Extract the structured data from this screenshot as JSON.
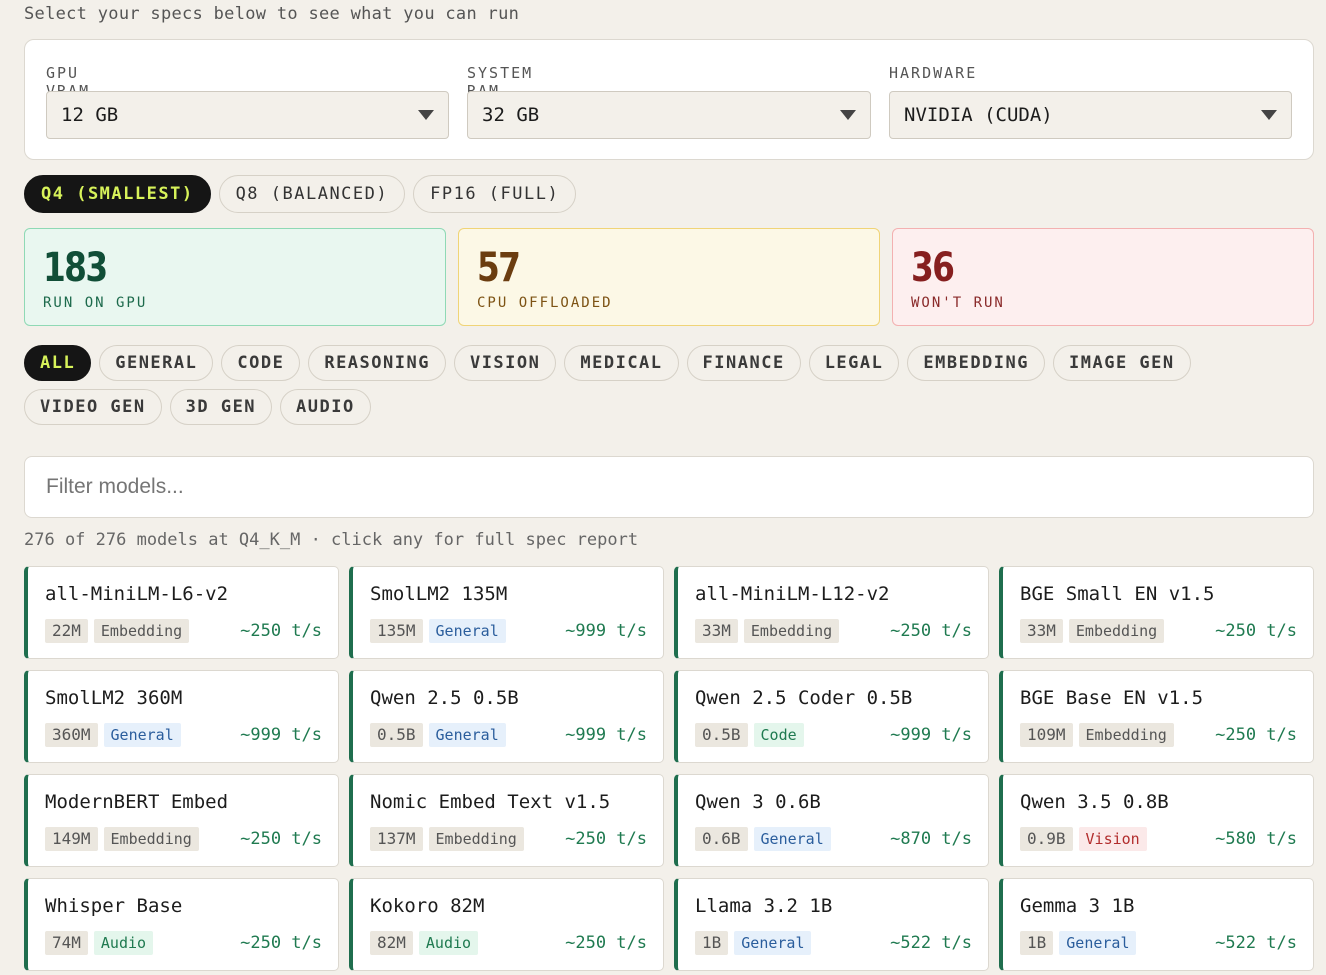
{
  "subtitle": "Select your specs below to see what you can run",
  "specs": [
    {
      "label": "GPU VRAM",
      "value": "12 GB"
    },
    {
      "label": "SYSTEM RAM",
      "value": "32 GB"
    },
    {
      "label": "HARDWARE",
      "value": "NVIDIA (CUDA)"
    }
  ],
  "quant_options": [
    {
      "label": "Q4 (SMALLEST)",
      "active": true
    },
    {
      "label": "Q8 (BALANCED)",
      "active": false
    },
    {
      "label": "FP16 (FULL)",
      "active": false
    }
  ],
  "stats": [
    {
      "value": "183",
      "label": "RUN ON GPU",
      "tone": "green"
    },
    {
      "value": "57",
      "label": "CPU OFFLOADED",
      "tone": "yellow"
    },
    {
      "value": "36",
      "label": "WON'T RUN",
      "tone": "red"
    }
  ],
  "categories_row1": [
    "ALL",
    "GENERAL",
    "CODE",
    "REASONING",
    "VISION",
    "MEDICAL",
    "FINANCE",
    "LEGAL",
    "EMBEDDING",
    "IMAGE GEN"
  ],
  "categories_row2": [
    "VIDEO GEN",
    "3D GEN",
    "AUDIO"
  ],
  "active_category": "ALL",
  "filter": {
    "placeholder": "Filter models..."
  },
  "count_line": "276 of 276 models at Q4_K_M · click any for full spec report",
  "models": [
    {
      "name": "all-MiniLM-L6-v2",
      "size": "22M",
      "category": "Embedding",
      "speed": "~250 t/s"
    },
    {
      "name": "SmolLM2 135M",
      "size": "135M",
      "category": "General",
      "speed": "~999 t/s"
    },
    {
      "name": "all-MiniLM-L12-v2",
      "size": "33M",
      "category": "Embedding",
      "speed": "~250 t/s"
    },
    {
      "name": "BGE Small EN v1.5",
      "size": "33M",
      "category": "Embedding",
      "speed": "~250 t/s"
    },
    {
      "name": "SmolLM2 360M",
      "size": "360M",
      "category": "General",
      "speed": "~999 t/s"
    },
    {
      "name": "Qwen 2.5 0.5B",
      "size": "0.5B",
      "category": "General",
      "speed": "~999 t/s"
    },
    {
      "name": "Qwen 2.5 Coder 0.5B",
      "size": "0.5B",
      "category": "Code",
      "speed": "~999 t/s"
    },
    {
      "name": "BGE Base EN v1.5",
      "size": "109M",
      "category": "Embedding",
      "speed": "~250 t/s"
    },
    {
      "name": "ModernBERT Embed",
      "size": "149M",
      "category": "Embedding",
      "speed": "~250 t/s"
    },
    {
      "name": "Nomic Embed Text v1.5",
      "size": "137M",
      "category": "Embedding",
      "speed": "~250 t/s"
    },
    {
      "name": "Qwen 3 0.6B",
      "size": "0.6B",
      "category": "General",
      "speed": "~870 t/s"
    },
    {
      "name": "Qwen 3.5 0.8B",
      "size": "0.9B",
      "category": "Vision",
      "speed": "~580 t/s"
    },
    {
      "name": "Whisper Base",
      "size": "74M",
      "category": "Audio",
      "speed": "~250 t/s"
    },
    {
      "name": "Kokoro 82M",
      "size": "82M",
      "category": "Audio",
      "speed": "~250 t/s"
    },
    {
      "name": "Llama 3.2 1B",
      "size": "1B",
      "category": "General",
      "speed": "~522 t/s"
    },
    {
      "name": "Gemma 3 1B",
      "size": "1B",
      "category": "General",
      "speed": "~522 t/s"
    }
  ]
}
